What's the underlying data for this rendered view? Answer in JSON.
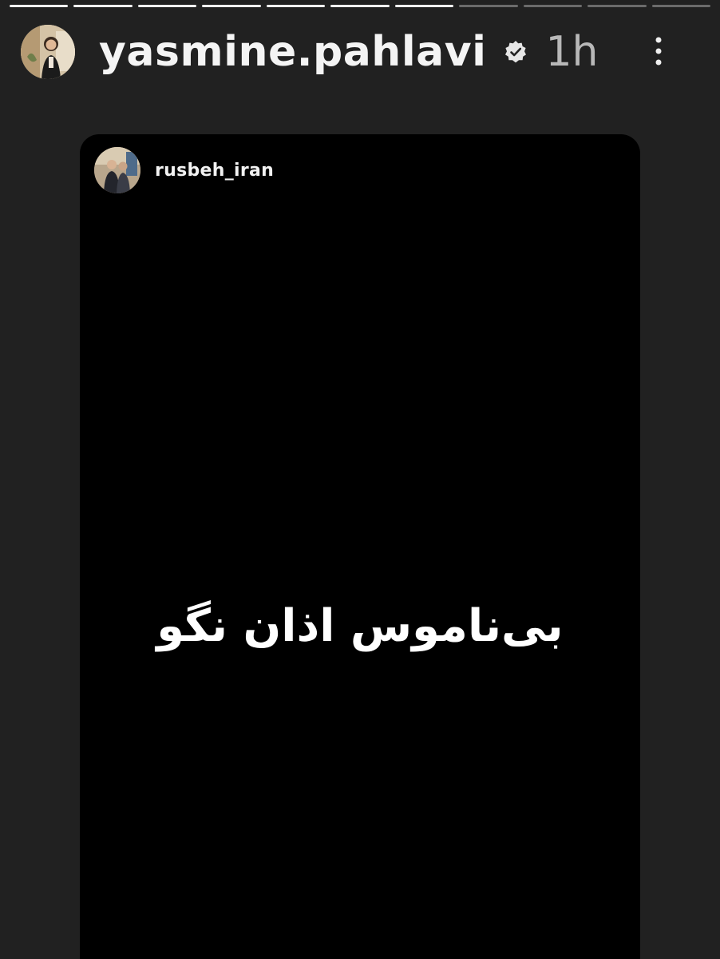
{
  "progress": {
    "total_segments": 11,
    "completed_segments": 7
  },
  "header": {
    "username": "yasmine.pahlavi",
    "verified": true,
    "time": "1h",
    "avatar_icon": "profile-photo-icon",
    "more_icon": "more-vertical-icon"
  },
  "shared_post": {
    "username": "rusbeh_iran",
    "avatar_icon": "profile-photo-icon",
    "text": "بی‌ناموس اذان نگو"
  },
  "colors": {
    "background": "#212121",
    "card": "#000000",
    "text": "#ffffff",
    "progress_done": "#f2f2f2",
    "progress_pending": "#6b6b6b"
  }
}
